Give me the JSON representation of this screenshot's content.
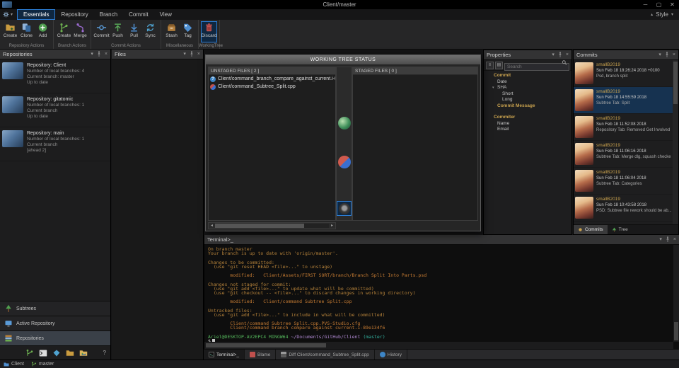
{
  "colors": {
    "accent_blue": "#2b7cd3",
    "selection_blue": "#163250",
    "author_gold": "#c9a24e",
    "terminal_amber": "#b5823a",
    "terminal_orange": "#c77c33"
  },
  "window": {
    "title": "Client/master",
    "controls": {
      "minimize": "─",
      "maximize": "▢",
      "close": "✕"
    }
  },
  "menu": {
    "tabs": [
      {
        "label": "Essentials",
        "active": true
      },
      {
        "label": "Repository"
      },
      {
        "label": "Branch"
      },
      {
        "label": "Commit"
      },
      {
        "label": "View"
      }
    ],
    "style_label": "Style"
  },
  "ribbon": {
    "groups": [
      {
        "label": "Repository Actions",
        "buttons": [
          {
            "label": "Create"
          },
          {
            "label": "Clone"
          },
          {
            "label": "Add"
          }
        ]
      },
      {
        "label": "Branch Actions",
        "buttons": [
          {
            "label": "Create"
          },
          {
            "label": "Merge"
          }
        ]
      },
      {
        "label": "Commit Actions",
        "buttons": [
          {
            "label": "Commit"
          },
          {
            "label": "Push"
          },
          {
            "label": "Pull"
          },
          {
            "label": "Sync"
          }
        ]
      },
      {
        "label": "Miscellaneous",
        "buttons": [
          {
            "label": "Stash"
          },
          {
            "label": "Tag"
          }
        ]
      },
      {
        "label": "WorkingTree",
        "buttons": [
          {
            "label": "Discard"
          }
        ]
      }
    ]
  },
  "repositories": {
    "title": "Repositories",
    "items": [
      {
        "title": "Repository: Client",
        "lines": [
          "Number of local branches: 4",
          "Current branch: master",
          "Up to date"
        ]
      },
      {
        "title": "Repository: gitatomic",
        "lines": [
          "Number of local branches: 1",
          "Current branch",
          "Up to date"
        ]
      },
      {
        "title": "Repository: main",
        "lines": [
          "Number of local branches: 1",
          "Current branch",
          "[ahead 2]"
        ]
      }
    ],
    "sections": [
      {
        "label": "Subtrees"
      },
      {
        "label": "Active Repository"
      },
      {
        "label": "Repositories"
      }
    ],
    "help_label": "?"
  },
  "files": {
    "title": "Files"
  },
  "working_tree": {
    "title": "WORKING TREE STATUS",
    "unstaged": {
      "header": "UNSTAGED FILES [ 2 ]",
      "files": [
        {
          "name": "Client/command_branch_compare_against_current.i-89...",
          "status": "untracked",
          "badge": "?"
        },
        {
          "name": "Client/command_Subtree_Split.cpp",
          "status": "modified",
          "badge": ""
        }
      ]
    },
    "staged": {
      "header": "STAGED FILES [ 0 ]",
      "files": []
    }
  },
  "properties": {
    "title": "Properties",
    "search_placeholder": "Search",
    "tree": [
      {
        "label": "Commit",
        "cls": "lvl0 cat"
      },
      {
        "label": "Date",
        "cls": "lvl1"
      },
      {
        "label": "SHA",
        "cls": "lvl1 exp"
      },
      {
        "label": "Short",
        "cls": "lvl2"
      },
      {
        "label": "Long",
        "cls": "lvl2"
      },
      {
        "label": "Commit Message",
        "cls": "lvl1 cat"
      },
      {
        "label": "Commiter",
        "cls": "lvl0 cat gap"
      },
      {
        "label": "Name",
        "cls": "lvl1"
      },
      {
        "label": "Email",
        "cls": "lvl1"
      }
    ]
  },
  "commits": {
    "title": "Commits",
    "items": [
      {
        "author": "smallB2019",
        "date": "Sun Feb 18 18:26:24 2018 +0100",
        "message": "Psd, branch split",
        "cls": ""
      },
      {
        "author": "smallB2019",
        "date": "Sun Feb 18 14:55:59 2018",
        "message": "Subtree Tab: Split",
        "cls": "selected"
      },
      {
        "author": "smallB2019",
        "date": "Sun Feb 18 11:52:08 2018",
        "message": "Repository Tab: Removed Get Involved ...",
        "cls": ""
      },
      {
        "author": "smallB2019",
        "date": "Sun Feb 18 11:06:16 2018",
        "message": "Subtree Tab: Merge dlg, squash checke...",
        "cls": ""
      },
      {
        "author": "smallB2019",
        "date": "Sun Feb 18 11:06:04 2018",
        "message": "Subtree Tab: Categories",
        "cls": ""
      },
      {
        "author": "smallB2019",
        "date": "Sun Feb 18 10:43:58 2018",
        "message": "PSD: Subtree file rework should be ab...",
        "cls": ""
      }
    ],
    "tabs": [
      {
        "label": "Commits",
        "active": true
      },
      {
        "label": "Tree"
      }
    ]
  },
  "terminal": {
    "title": "Terminal>_",
    "lines": [
      {
        "text": "On branch master",
        "cls": "amber"
      },
      {
        "text": "Your branch is up to date with 'origin/master'.",
        "cls": "amber"
      },
      {
        "text": "",
        "cls": ""
      },
      {
        "text": "Changes to be committed:",
        "cls": "amber"
      },
      {
        "text": "  (use \"git reset HEAD <file>...\" to unstage)",
        "cls": "amber"
      },
      {
        "text": "",
        "cls": ""
      },
      {
        "text": "        modified:   Client/Assets/FIRST SORT/branch/Branch Split Into Parts.psd",
        "cls": "file"
      },
      {
        "text": "",
        "cls": ""
      },
      {
        "text": "Changes not staged for commit:",
        "cls": "amber"
      },
      {
        "text": "  (use \"git add <file>...\" to update what will be committed)",
        "cls": "amber"
      },
      {
        "text": "  (use \"git checkout -- <file>...\" to discard changes in working directory)",
        "cls": "amber"
      },
      {
        "text": "",
        "cls": ""
      },
      {
        "text": "        modified:   Client/command Subtree Split.cpp",
        "cls": "file"
      },
      {
        "text": "",
        "cls": ""
      },
      {
        "text": "Untracked files:",
        "cls": "amber"
      },
      {
        "text": "  (use \"git add <file>...\" to include in what will be committed)",
        "cls": "amber"
      },
      {
        "text": "",
        "cls": ""
      },
      {
        "text": "        Client/command Subtree Split.cpp.PVS-Studio.cfg",
        "cls": "file"
      },
      {
        "text": "        Client/command branch compare against current.i-89e134f6",
        "cls": "file"
      },
      {
        "text": "",
        "cls": ""
      }
    ],
    "prompt": {
      "user": "Ariel@DESKTOP-AV2EPC4 MINGW64",
      "path": "~/Documents/GitHub/Client",
      "branch": "(master)",
      "dollar": "$"
    }
  },
  "bottom_tabs": [
    {
      "label": "Terminal>_",
      "active": true
    },
    {
      "label": "Blame"
    },
    {
      "label": "Diff Client/command_Subtree_Split.cpp"
    },
    {
      "label": "History"
    }
  ],
  "statusbar": {
    "repo": "Client",
    "branch": "master"
  }
}
